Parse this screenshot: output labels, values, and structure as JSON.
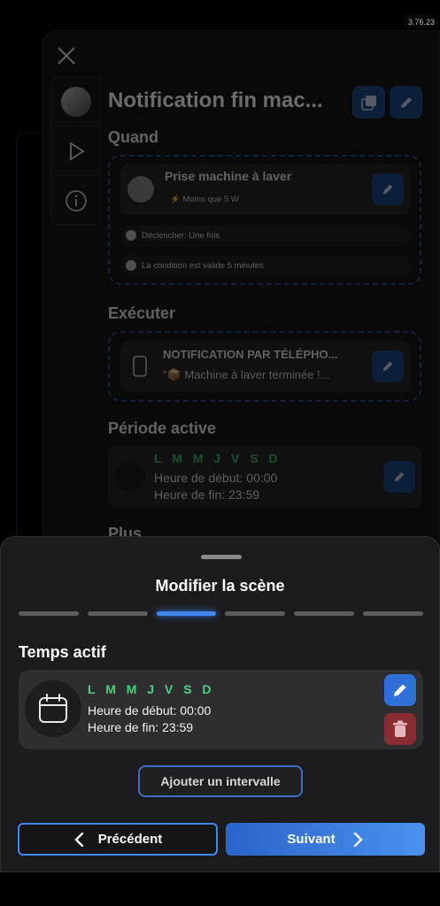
{
  "version": "3.76.23",
  "background": {
    "title": "Notification fin mac...",
    "sections": {
      "when": "Quand",
      "execute": "Exécuter",
      "active_period": "Période active",
      "more": "Plus"
    },
    "trigger": {
      "name": "Prise machine à laver",
      "condition": "Moins que 5 W",
      "trigger_mode": "Déclencher: Une fois",
      "validity": "La condition est valide 5 minutes"
    },
    "action": {
      "name": "NOTIFICATION PAR TÉLÉPHO...",
      "message": "\"📦 Machine à laver terminée !..."
    },
    "period": {
      "days": "L M M J V S D",
      "start": "Heure de début: 00:00",
      "end": "Heure de fin: 23:59"
    }
  },
  "sheet": {
    "title": "Modifier la scène",
    "steps_total": 6,
    "active_step": 3,
    "section_title": "Temps actif",
    "interval": {
      "days": "L M M J V S D",
      "start": "Heure de début: 00:00",
      "end": "Heure de fin: 23:59"
    },
    "add_interval": "Ajouter un intervalle",
    "previous": "Précédent",
    "next": "Suivant"
  },
  "colors": {
    "accent": "#3f86ef",
    "days_green": "#4fcf7d",
    "delete_red": "#8a2d33"
  }
}
